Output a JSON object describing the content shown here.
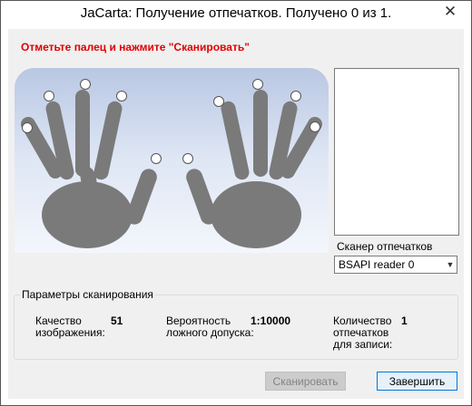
{
  "window": {
    "title": "JaCarta: Получение отпечатков. Получено 0 из 1.",
    "close_icon": "close-icon"
  },
  "instruction": "Отметьте палец и нажмите \"Сканировать\"",
  "hands": {
    "left_icon": "left-hand-icon",
    "right_icon": "right-hand-icon",
    "finger_selectors": 10
  },
  "scanner": {
    "label": "Сканер отпечатков",
    "selected": "BSAPI reader 0"
  },
  "params": {
    "title": "Параметры сканирования",
    "quality_label": "Качество изображения:",
    "quality_value": "51",
    "far_label": "Вероятность ложного допуска:",
    "far_value": "1:10000",
    "count_label": "Количество отпечатков для записи:",
    "count_value": "1"
  },
  "buttons": {
    "scan": "Сканировать",
    "finish": "Завершить"
  },
  "colors": {
    "instruction": "#e00000",
    "hand": "#7a7a7a",
    "finish_border": "#0078d7"
  }
}
